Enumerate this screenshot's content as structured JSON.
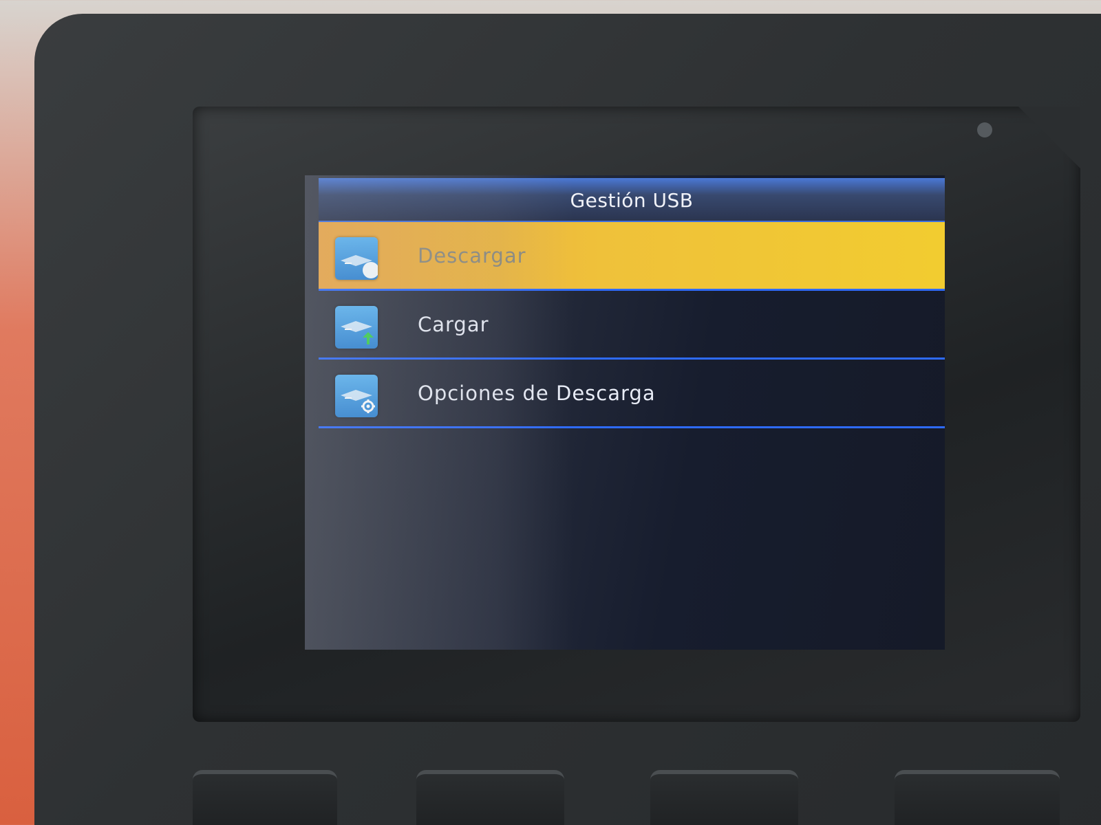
{
  "screen": {
    "title": "Gestión USB",
    "menu_items": [
      {
        "label": "Descargar",
        "icon": "usb-download-icon",
        "selected": true
      },
      {
        "label": "Cargar",
        "icon": "usb-upload-icon",
        "selected": false
      },
      {
        "label": "Opciones de Descarga",
        "icon": "usb-settings-icon",
        "selected": false
      }
    ]
  },
  "colors": {
    "title_bar": "#38496f",
    "selection_highlight": "#f2cc30",
    "divider": "#2e6bff",
    "screen_background": "#171d2e",
    "device_body": "#2e3133"
  }
}
